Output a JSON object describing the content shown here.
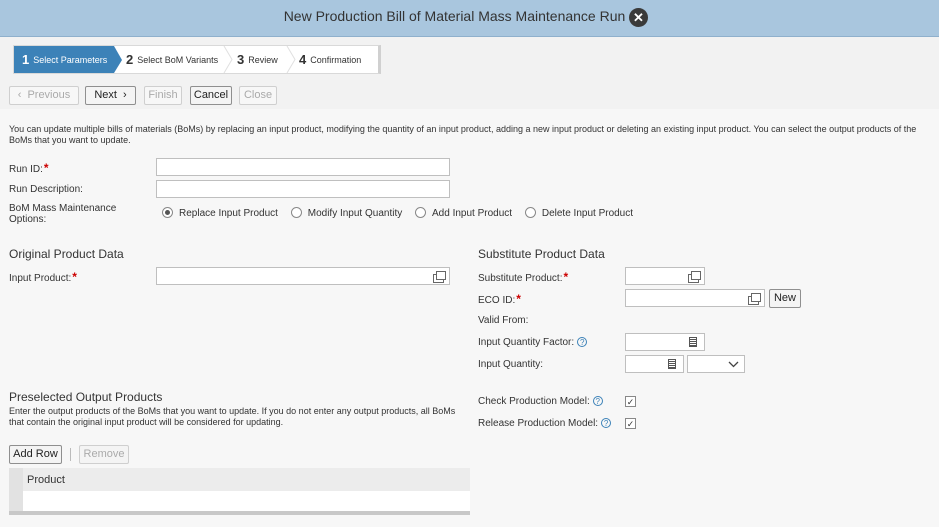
{
  "title": "New Production Bill of Material Mass Maintenance Run",
  "steps": [
    {
      "num": "1",
      "label": "Select Parameters"
    },
    {
      "num": "2",
      "label": "Select BoM Variants"
    },
    {
      "num": "3",
      "label": "Review"
    },
    {
      "num": "4",
      "label": "Confirmation"
    }
  ],
  "toolbar": {
    "previous": "Previous",
    "next": "Next",
    "finish": "Finish",
    "cancel": "Cancel",
    "close": "Close"
  },
  "intro": "You can update multiple bills of materials (BoMs) by replacing an input product, modifying the quantity of an input product, adding a new input product or deleting an existing input product. You can select the output products of the BoMs that you want to update.",
  "form": {
    "run_id_label": "Run ID:",
    "run_description_label": "Run Description:",
    "options_label_1": "BoM Mass Maintenance",
    "options_label_2": "Options:",
    "options": [
      "Replace Input Product",
      "Modify Input Quantity",
      "Add Input Product",
      "Delete Input Product"
    ],
    "required_mark": "*"
  },
  "original": {
    "heading": "Original Product Data",
    "input_product_label": "Input Product:"
  },
  "substitute": {
    "heading": "Substitute Product Data",
    "substitute_product_label": "Substitute Product:",
    "eco_id_label": "ECO ID:",
    "new_button": "New",
    "valid_from_label": "Valid From:",
    "input_quantity_factor_label": "Input Quantity Factor:",
    "input_quantity_label": "Input Quantity:",
    "check_production_model_label": "Check Production Model:",
    "release_production_model_label": "Release Production Model:",
    "help_glyph": "?",
    "check_glyph": "✓"
  },
  "preselected": {
    "heading": "Preselected Output Products",
    "description": "Enter the output products of the BoMs that you want to update. If you do not enter any output products, all BoMs that contain the original input product will be considered for updating.",
    "add_row": "Add Row",
    "remove": "Remove",
    "column_product": "Product"
  },
  "icons": {
    "close": "close-icon",
    "value_help": "value-help-icon",
    "calculator": "calculator-icon",
    "dropdown": "chevron-down-icon",
    "prev": "chevron-left-icon",
    "next": "chevron-right-icon"
  }
}
